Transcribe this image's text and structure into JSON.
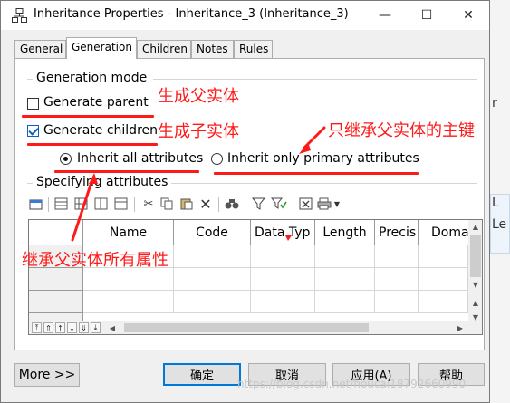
{
  "window": {
    "title": "Inheritance Properties - Inheritance_3 (Inheritance_3)",
    "icon": "inheritance-icon",
    "minimize": "—",
    "maximize": "☐",
    "close": "✕"
  },
  "background_app": {
    "fragments": [
      "r",
      "L",
      "Le"
    ]
  },
  "tabs": [
    {
      "label": "General",
      "active": false
    },
    {
      "label": "Generation",
      "active": true
    },
    {
      "label": "Children",
      "active": false
    },
    {
      "label": "Notes",
      "active": false
    },
    {
      "label": "Rules",
      "active": false
    }
  ],
  "generation_mode": {
    "label": "Generation mode",
    "generate_parent": {
      "label": "Generate parent",
      "checked": false
    },
    "generate_children": {
      "label": "Generate children",
      "checked": true
    }
  },
  "inherit_options": {
    "all": {
      "label": "Inherit all attributes",
      "selected": true
    },
    "primary": {
      "label": "Inherit only primary attributes",
      "selected": false
    }
  },
  "specifying": {
    "label": "Specifying attributes",
    "columns": [
      "Name",
      "Code",
      "Data Typ",
      "Length",
      "Precis",
      "Doma"
    ],
    "row_count": 3
  },
  "buttons": {
    "more": "More >>",
    "ok": "确定",
    "cancel": "取消",
    "apply": "应用(A)",
    "help": "帮助"
  },
  "annotations": {
    "parent": "生成父实体",
    "children": "生成子实体",
    "primary": "只继承父实体的主键",
    "all": "继承父实体所有属性",
    "color": "#ff1a1a"
  },
  "watermark": "https://blog.csdn.net/houcai18792660990"
}
